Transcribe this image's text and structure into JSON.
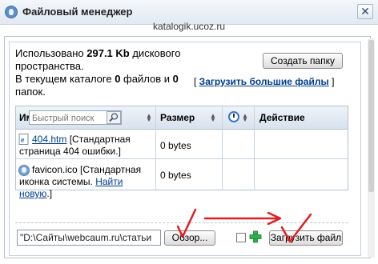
{
  "window": {
    "title": "Файловый менеджер",
    "close_glyph": "✕",
    "url": "katalogik.ucoz.ru"
  },
  "info": {
    "used_prefix": "Использовано ",
    "used_amount": "297.1 Kb",
    "used_suffix": " дискового пространства.",
    "dir_prefix": "В текущем каталоге ",
    "files_count": "0",
    "files_mid": " файлов и ",
    "folders_count": "0",
    "folders_suffix": " папок."
  },
  "buttons": {
    "create_folder": "Создать папку",
    "browse": "Обзор...",
    "upload_file": "Загрузить файл"
  },
  "upload_more": {
    "open": "[ ",
    "label": "Загрузить большие файлы",
    "close": " ]"
  },
  "table": {
    "col_name_partial": "Им",
    "search_placeholder": "Быстрый поиск",
    "col_size": "Размер",
    "col_action": "Действие",
    "rows": [
      {
        "name": "404.htm",
        "desc": "[Стандартная страница 404 ошибки.]",
        "size": "0 bytes",
        "icon": "ie-page-icon"
      },
      {
        "name": "favicon.ico",
        "desc_pre": "[Стандартная иконка системы. ",
        "desc_link": "Найти новую",
        "desc_post": ".]",
        "size": "0 bytes",
        "icon": "favicon-icon"
      }
    ]
  },
  "upload": {
    "path_value": "\"D:\\Сайты\\webcaum.ru\\статьи"
  },
  "colors": {
    "link": "#003c8f",
    "annotation_red": "#e02020"
  }
}
